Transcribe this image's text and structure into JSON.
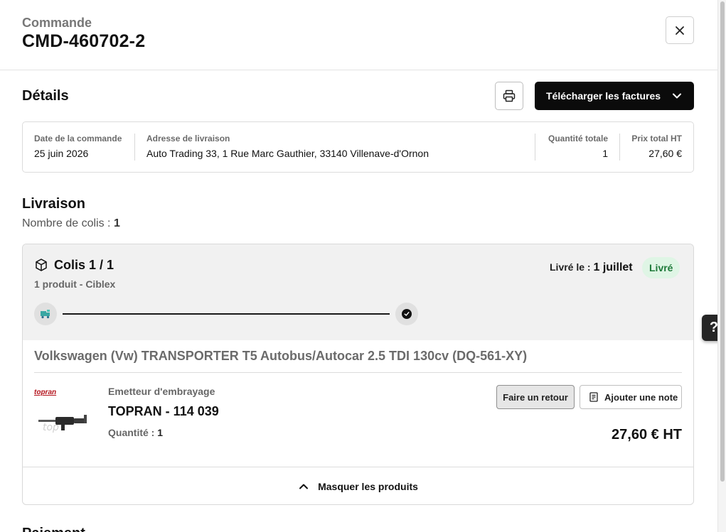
{
  "header": {
    "kicker": "Commande",
    "order_id": "CMD-460702-2",
    "close_icon": "close-icon"
  },
  "details": {
    "title": "Détails",
    "print_icon": "printer-icon",
    "download_label": "Télécharger les factures",
    "download_icon": "chevron-down-icon"
  },
  "summary": {
    "order_date_label": "Date de la commande",
    "order_date": "25 juin 2026",
    "address_label": "Adresse de livraison",
    "address": "Auto Trading 33, 1 Rue Marc Gauthier, 33140 Villenave-d'Ornon",
    "qty_label": "Quantité totale",
    "qty": "1",
    "total_label": "Prix total HT",
    "total": "27,60 €"
  },
  "delivery": {
    "title": "Livraison",
    "colis_count_label": "Nombre de colis :",
    "colis_count": "1"
  },
  "package": {
    "icon": "package-icon",
    "title": "Colis 1 / 1",
    "subtitle": "1 produit - Ciblex",
    "delivered_label": "Livré le :",
    "delivered_date": "1 juillet",
    "status": "Livré",
    "status_color": "#1f7a3a",
    "status_bg": "#dff5e5",
    "track_start_icon": "truck-icon",
    "track_end_icon": "check-circle-icon",
    "progress": 1.0
  },
  "vehicle": {
    "label": "Volkswagen (Vw) TRANSPORTER T5 Autobus/Autocar 2.5 TDI 130cv (DQ-561-XY)"
  },
  "product": {
    "brand": "topran",
    "category": "Emetteur d'embrayage",
    "name": "TOPRAN - 114 039",
    "qty_label": "Quantité :",
    "qty": "1",
    "price": "27,60 € HT",
    "return_label": "Faire un retour",
    "note_label": "Ajouter une note",
    "note_icon": "note-icon"
  },
  "products_toggle": {
    "label": "Masquer les produits",
    "icon": "chevron-up-icon"
  },
  "next_section": {
    "title": "Paiement"
  },
  "help": {
    "label": "?"
  }
}
